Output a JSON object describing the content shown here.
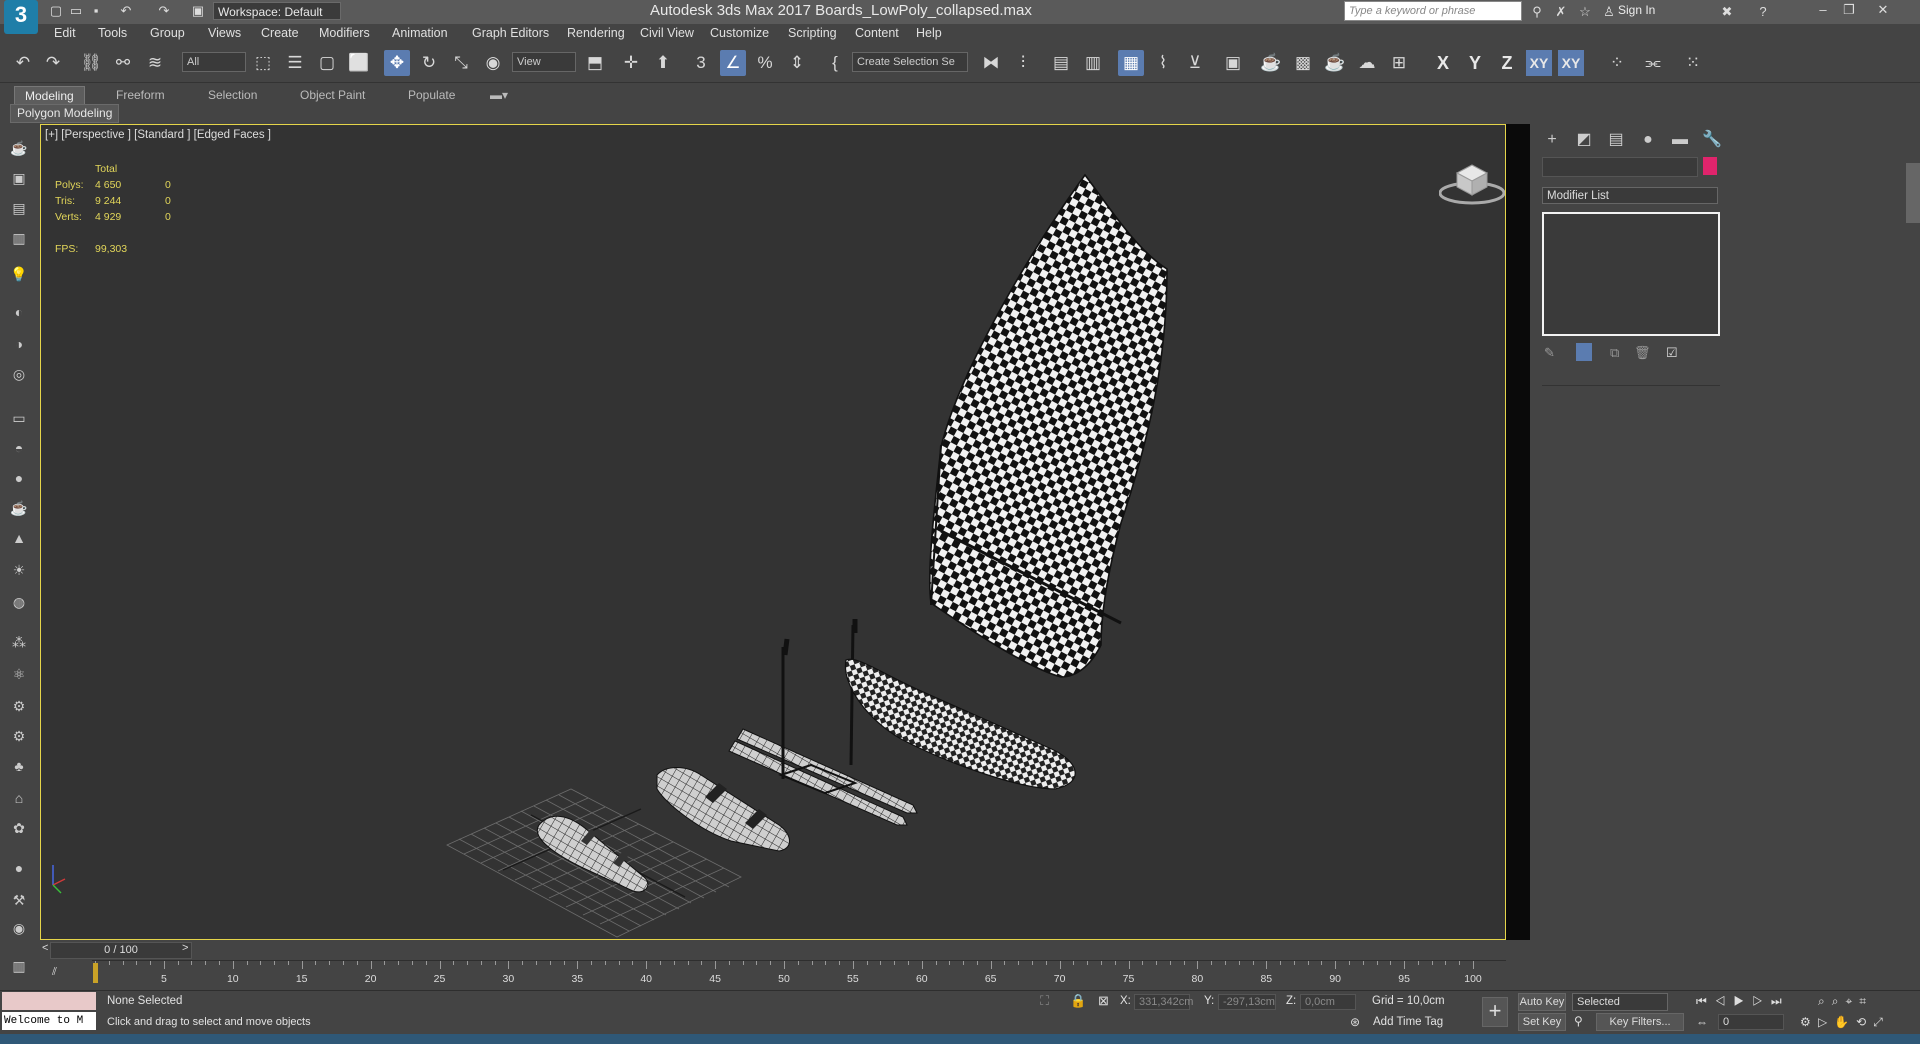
{
  "titlebar": {
    "app_logo": "3",
    "workspace": "Workspace: Default",
    "title": "Autodesk 3ds Max 2017     Boards_LowPoly_collapsed.max",
    "search_placeholder": "Type a keyword or phrase",
    "sign_in": "Sign In",
    "minimize": "–",
    "restore": "❐",
    "close": "✕"
  },
  "menu": [
    "Edit",
    "Tools",
    "Group",
    "Views",
    "Create",
    "Modifiers",
    "Animation",
    "Graph Editors",
    "Rendering",
    "Civil View",
    "Customize",
    "Scripting",
    "Content",
    "Help"
  ],
  "toolbar": {
    "selection_filter": "All",
    "ref_coord": "View",
    "named_selection": "Create Selection Se",
    "axis": [
      "X",
      "Y",
      "Z",
      "XY",
      "XY"
    ]
  },
  "ribbon": {
    "tabs": [
      "Modeling",
      "Freeform",
      "Selection",
      "Object Paint",
      "Populate"
    ],
    "active_tab": "Modeling",
    "panel": "Polygon Modeling"
  },
  "viewport": {
    "label": "[+] [Perspective ] [Standard ] [Edged Faces ]",
    "stats": {
      "header": "Total",
      "rows": [
        {
          "label": "Polys:",
          "total": "4 650",
          "sel": "0"
        },
        {
          "label": "Tris:",
          "total": "9 244",
          "sel": "0"
        },
        {
          "label": "Verts:",
          "total": "4 929",
          "sel": "0"
        }
      ],
      "fps_label": "FPS:",
      "fps_value": "99,303"
    }
  },
  "command_panel": {
    "modifier_list": "Modifier List",
    "swatch_color": "#e0246c"
  },
  "time": {
    "frame": "0 / 100",
    "track_labels": [
      "5",
      "10",
      "15",
      "20",
      "25",
      "30",
      "35",
      "40",
      "45",
      "50",
      "55",
      "60",
      "65",
      "70",
      "75",
      "80",
      "85",
      "90",
      "95",
      "100"
    ],
    "track_label_frames": [
      5,
      10,
      15,
      20,
      25,
      30,
      35,
      40,
      45,
      50,
      55,
      60,
      65,
      70,
      75,
      80,
      85,
      90,
      95,
      100
    ]
  },
  "status": {
    "maxscript": "Welcome to M",
    "selection": "None Selected",
    "prompt": "Click and drag to select and move objects",
    "x_label": "X:",
    "x_value": "331,342cm",
    "y_label": "Y:",
    "y_value": "-297,13cm",
    "z_label": "Z:",
    "z_value": "0,0cm",
    "grid": "Grid = 10,0cm",
    "add_time_tag": "Add Time Tag",
    "auto_key": "Auto Key",
    "set_key": "Set Key",
    "key_mode": "Selected",
    "key_filters": "Key Filters...",
    "frame_field": "0"
  }
}
